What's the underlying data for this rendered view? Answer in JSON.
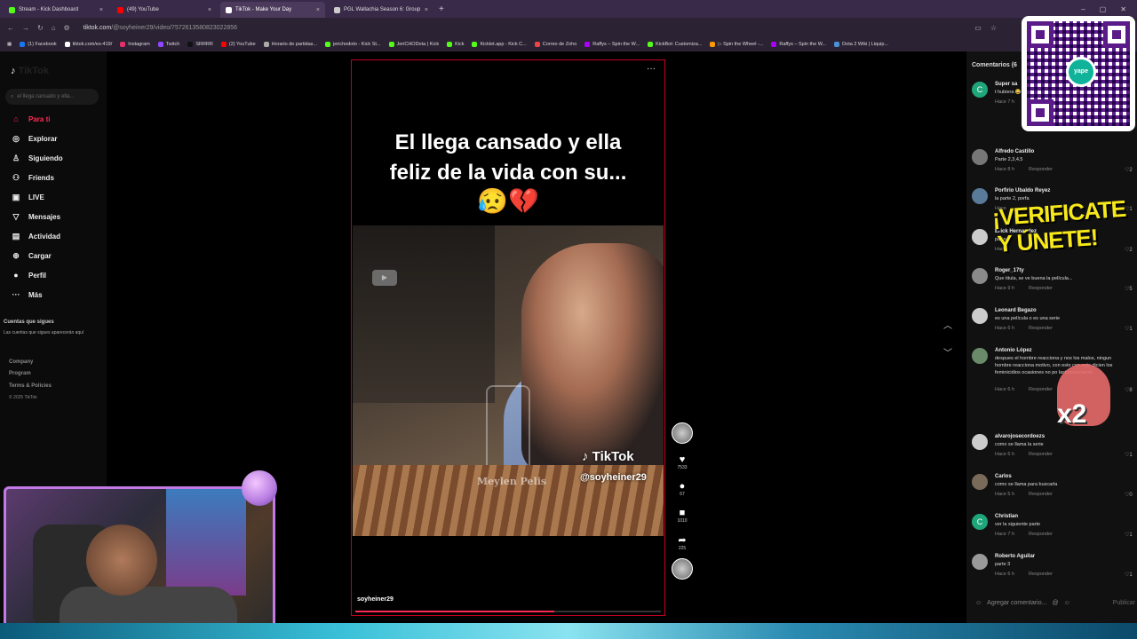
{
  "tabs": [
    {
      "title": "Stream - Kick Dashboard",
      "color": "#53fc18",
      "active": false
    },
    {
      "title": "(49) YouTube",
      "color": "#ff0000",
      "active": false
    },
    {
      "title": "TikTok - Make Your Day",
      "color": "#ffffff",
      "active": true
    },
    {
      "title": "PGL Wallachia Season 6: Group",
      "color": "#cccccc",
      "active": false
    }
  ],
  "address": {
    "host": "tiktok.com",
    "path": "/@soyheiner29/video/7572613580823022856"
  },
  "bookmarks": [
    {
      "label": "(1) Facebook",
      "color": "#1877f2"
    },
    {
      "label": "tiktok.com/es-419/",
      "color": "#ffffff"
    },
    {
      "label": "Instagram",
      "color": "#e1306c"
    },
    {
      "label": "Twitch",
      "color": "#9146ff"
    },
    {
      "label": "SRRRR",
      "color": "#111111"
    },
    {
      "label": "(2) YouTube",
      "color": "#ff0000"
    },
    {
      "label": "Horario de partidas...",
      "color": "#aaaaaa"
    },
    {
      "label": "jerichodoto - Kick St...",
      "color": "#53fc18"
    },
    {
      "label": "JeriCHODota | Kick",
      "color": "#53fc18"
    },
    {
      "label": "Kick",
      "color": "#53fc18"
    },
    {
      "label": "Kicklet.app - Kick C...",
      "color": "#53fc18"
    },
    {
      "label": "Correo de Zoho",
      "color": "#e44"
    },
    {
      "label": "Raffys – Spin the W...",
      "color": "#a0f"
    },
    {
      "label": "KickBot: Customiza...",
      "color": "#53fc18"
    },
    {
      "label": "▷ Spin the Wheel -...",
      "color": "#f90"
    },
    {
      "label": "Raffys – Spin the W...",
      "color": "#a0f"
    },
    {
      "label": "Dota 2 Wiki | Liquip...",
      "color": "#4a90d9"
    }
  ],
  "sidebar": {
    "logo": "TikTok",
    "search_placeholder": "el llega cansado y ella...",
    "nav": [
      {
        "label": "Para ti",
        "icon": "home-icon",
        "glyph": "⌂",
        "active": true
      },
      {
        "label": "Explorar",
        "icon": "compass-icon",
        "glyph": "◎",
        "active": false
      },
      {
        "label": "Siguiendo",
        "icon": "user-icon",
        "glyph": "♙",
        "active": false
      },
      {
        "label": "Friends",
        "icon": "friends-icon",
        "glyph": "⚇",
        "active": false
      },
      {
        "label": "LIVE",
        "icon": "live-icon",
        "glyph": "▣",
        "active": false
      },
      {
        "label": "Mensajes",
        "icon": "send-icon",
        "glyph": "▽",
        "active": false
      },
      {
        "label": "Actividad",
        "icon": "activity-icon",
        "glyph": "▤",
        "active": false
      },
      {
        "label": "Cargar",
        "icon": "upload-icon",
        "glyph": "⊕",
        "active": false
      },
      {
        "label": "Perfil",
        "icon": "profile-icon",
        "glyph": "●",
        "active": false
      },
      {
        "label": "Más",
        "icon": "more-icon",
        "glyph": "···",
        "active": false
      }
    ],
    "following_heading": "Cuentas que sigues",
    "following_text": "Las cuentas que sigues aparecerán aquí",
    "footer": [
      "Company",
      "Program",
      "Terms & Policies"
    ],
    "copyright": "© 2025 TikTok"
  },
  "video": {
    "caption_line1": "El llega cansado y ella",
    "caption_line2": "feliz de la vida con su...",
    "emojis": "😥💔",
    "watermark": "TikTok",
    "watermark_user": "@soyheiner29",
    "overlay_text": "Meylen Pelis",
    "author": "soyheiner29",
    "progress": 0.65
  },
  "actions": {
    "likes": "7533",
    "comments": "67",
    "saves": "1010",
    "shares": "225"
  },
  "comments_panel": {
    "header": "Comentarios (6",
    "add_placeholder": "Agregar comentario...",
    "publish": "Publicar",
    "items": [
      {
        "initial": "C",
        "color": "#1fa57a",
        "name": "Super sa",
        "text": "t hubiera 😂😂",
        "time": "Hace 7 h",
        "reply": "",
        "likes": ""
      },
      {
        "initial": "",
        "color": "#777777",
        "name": "Alfredo Castillo",
        "text": "Parte 2,3,4,5",
        "time": "Hace 8 h",
        "reply": "Responder",
        "likes": "2"
      },
      {
        "initial": "",
        "color": "#5a7a9a",
        "name": "Porfirio Ubaldo Reyez",
        "text": "la parte 2, porfa",
        "time": "Hace",
        "reply": "",
        "likes": "1"
      },
      {
        "initial": "",
        "color": "#cccccc",
        "name": "Erick Hernandez",
        "text": "parte 2",
        "time": "Hace",
        "reply": "",
        "likes": "2"
      },
      {
        "initial": "",
        "color": "#8a8a8a",
        "name": "Roger_17ty",
        "text": "Que titula, se ve buena la película...",
        "time": "Hace 9 h",
        "reply": "Responder",
        "likes": "5"
      },
      {
        "initial": "",
        "color": "#cccccc",
        "name": "Leonard Begazo",
        "text": "es una película o es una serie",
        "time": "Hace 6 h",
        "reply": "Responder",
        "likes": "1"
      },
      {
        "initial": "",
        "color": "#6a8a6a",
        "name": "Antonio López",
        "text": "despues el hombre reacciona y nos los malos, ningun hombre reacciona motivo, con esto con esto dicien los feminicidios ocasiones no po lastimosamente",
        "time": "Hace 6 h",
        "reply": "Responder",
        "likes": "8"
      },
      {
        "initial": "",
        "color": "#cccccc",
        "name": "alvarojosecordoezs",
        "text": "como se llama la serie",
        "time": "Hace 6 h",
        "reply": "Responder",
        "likes": "1"
      },
      {
        "initial": "",
        "color": "#7a6a5a",
        "name": "Carlos",
        "text": "como se llama para buscarla",
        "time": "Hace 5 h",
        "reply": "Responder",
        "likes": "0"
      },
      {
        "initial": "C",
        "color": "#1fa57a",
        "name": "Christian",
        "text": "ver la siguiente parte",
        "time": "Hace 7 h",
        "reply": "Responder",
        "likes": "1"
      },
      {
        "initial": "",
        "color": "#9a9a9a",
        "name": "Roberto Aguilar",
        "text": "parte 3",
        "time": "Hace 6 h",
        "reply": "Responder",
        "likes": "1"
      }
    ]
  },
  "overlays": {
    "verify_line1": "¡VERIFICATE",
    "verify_line2": "Y ÚNETE!",
    "qr_brand": "yape",
    "x2": "x2"
  }
}
